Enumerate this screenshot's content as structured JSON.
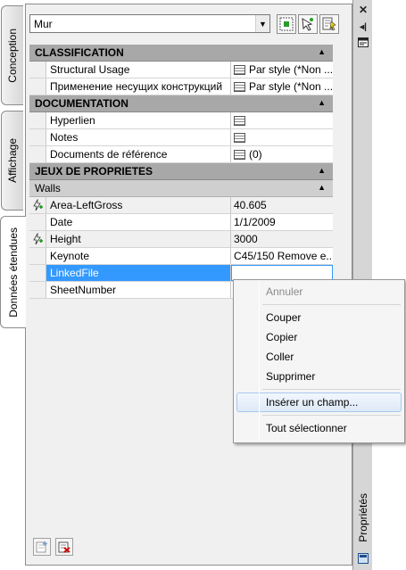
{
  "tabs": [
    {
      "label": "Conception"
    },
    {
      "label": "Affichage"
    },
    {
      "label": "Données étendues"
    }
  ],
  "toolbar": {
    "combo_value": "Mur",
    "buttons": [
      "select-objects-icon",
      "quick-select-icon",
      "toggle-pickadd-icon"
    ]
  },
  "right_strip": {
    "label": "Propriétés",
    "icons": [
      "close-icon",
      "autohide-icon",
      "properties-menu-icon"
    ]
  },
  "grid": {
    "classification": {
      "title": "CLASSIFICATION",
      "rows": [
        {
          "name": "Structural Usage",
          "value": "Par style (*Non ..."
        },
        {
          "name": "Применение несущих конструкций",
          "value": "Par style (*Non ..."
        }
      ]
    },
    "documentation": {
      "title": "DOCUMENTATION",
      "rows": [
        {
          "name": "Hyperlien",
          "value": ""
        },
        {
          "name": "Notes",
          "value": ""
        },
        {
          "name": "Documents de référence",
          "value": "(0)"
        }
      ]
    },
    "property_sets": {
      "title": "JEUX DE PROPRIETES",
      "subcategory": "Walls",
      "rows": [
        {
          "name": "Area-LeftGross",
          "value": "40.605"
        },
        {
          "name": "Date",
          "value": "1/1/2009"
        },
        {
          "name": "Height",
          "value": "3000"
        },
        {
          "name": "Keynote",
          "value": "C45/150 Remove e..."
        },
        {
          "name": "LinkedFile",
          "value": ""
        },
        {
          "name": "SheetNumber",
          "value": ""
        }
      ]
    }
  },
  "context_menu": {
    "items": [
      "Annuler",
      "Couper",
      "Copier",
      "Coller",
      "Supprimer",
      "Insérer un champ...",
      "Tout sélectionner"
    ]
  },
  "colors": {
    "selection": "#3399ff",
    "category_bg": "#a8a8a8",
    "panel_bg": "#f0f0f0"
  }
}
